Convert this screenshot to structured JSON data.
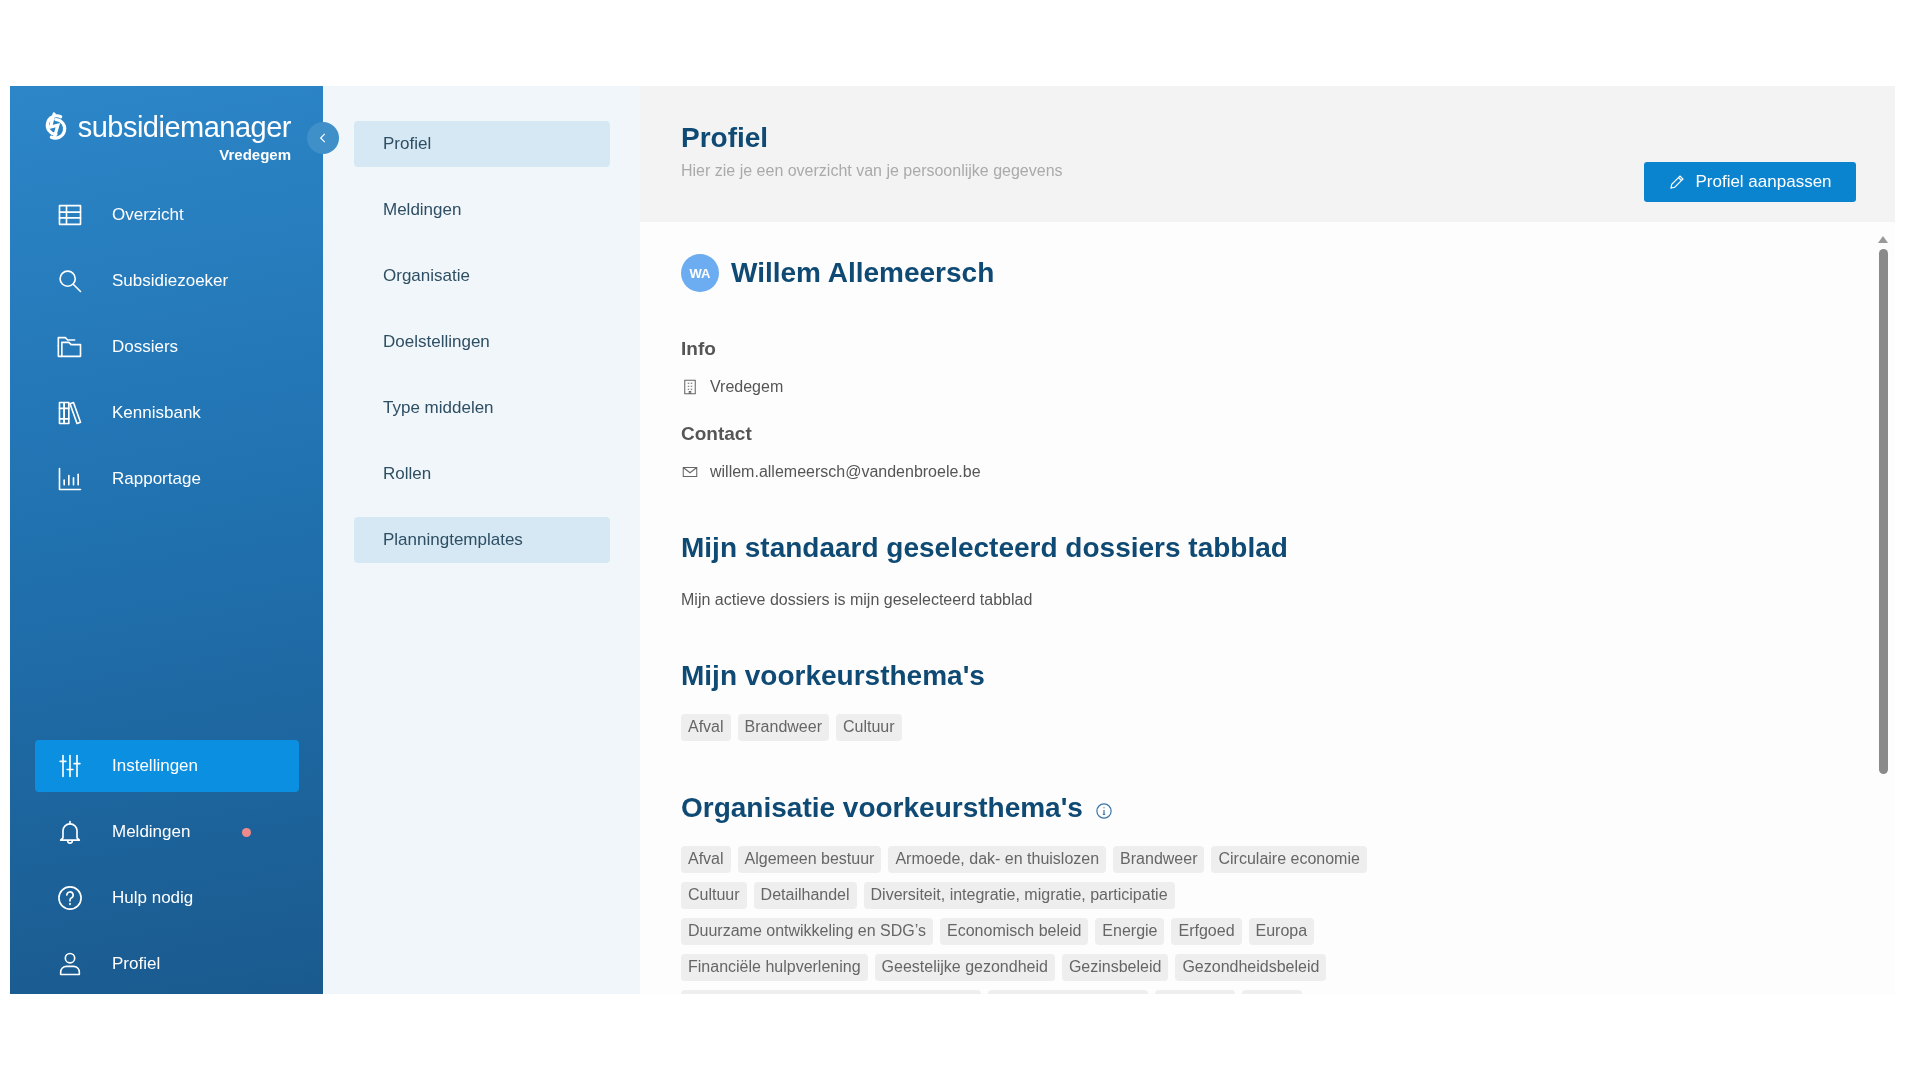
{
  "sidebar": {
    "logo_text": "subsidiemanager",
    "organization": "Vredegem",
    "items": [
      {
        "label": "Overzicht",
        "selected": false
      },
      {
        "label": "Subsidiezoeker",
        "selected": false
      },
      {
        "label": "Dossiers",
        "selected": false
      },
      {
        "label": "Kennisbank",
        "selected": false
      },
      {
        "label": "Rapportage",
        "selected": false
      }
    ],
    "bottom_items": [
      {
        "label": "Instellingen",
        "selected": true,
        "unread": false
      },
      {
        "label": "Meldingen",
        "selected": false,
        "unread": true
      },
      {
        "label": "Hulp nodig",
        "selected": false,
        "unread": false
      },
      {
        "label": "Profiel",
        "selected": false,
        "unread": false
      }
    ]
  },
  "submenu": {
    "items": [
      {
        "label": "Profiel",
        "highlighted": true
      },
      {
        "label": "Meldingen",
        "highlighted": false
      },
      {
        "label": "Organisatie",
        "highlighted": false
      },
      {
        "label": "Doelstellingen",
        "highlighted": false
      },
      {
        "label": "Type middelen",
        "highlighted": false
      },
      {
        "label": "Rollen",
        "highlighted": false
      },
      {
        "label": "Planningtemplates",
        "highlighted": true
      }
    ]
  },
  "header": {
    "title": "Profiel",
    "subtitle": "Hier zie je een overzicht van je persoonlijke gegevens",
    "edit_button": "Profiel aanpassen"
  },
  "profile": {
    "initials": "WA",
    "name": "Willem Allemeersch",
    "info": {
      "heading": "Info",
      "organization": "Vredegem"
    },
    "contact": {
      "heading": "Contact",
      "email": "willem.allemeersch@vandenbroele.be"
    },
    "default_tab": {
      "heading": "Mijn standaard geselecteerd dossiers tabblad",
      "text": "Mijn actieve dossiers is mijn geselecteerd tabblad"
    },
    "my_themes": {
      "heading": "Mijn voorkeursthema's",
      "tags": [
        "Afval",
        "Brandweer",
        "Cultuur"
      ]
    },
    "org_themes": {
      "heading": "Organisatie voorkeursthema's",
      "tag_rows": [
        [
          "Afval",
          "Algemeen bestuur",
          "Armoede, dak- en thuislozen",
          "Brandweer",
          "Circulaire economie"
        ],
        [
          "Cultuur",
          "Detailhandel",
          "Diversiteit, integratie, migratie, participatie"
        ],
        [
          "Duurzame ontwikkeling en SDG’s",
          "Economisch beleid",
          "Energie",
          "Erfgoed",
          "Europa"
        ],
        [
          "Financiële hulpverlening",
          "Geestelijke gezondheid",
          "Gezinsbeleid",
          "Gezondheidsbeleid"
        ]
      ]
    }
  }
}
